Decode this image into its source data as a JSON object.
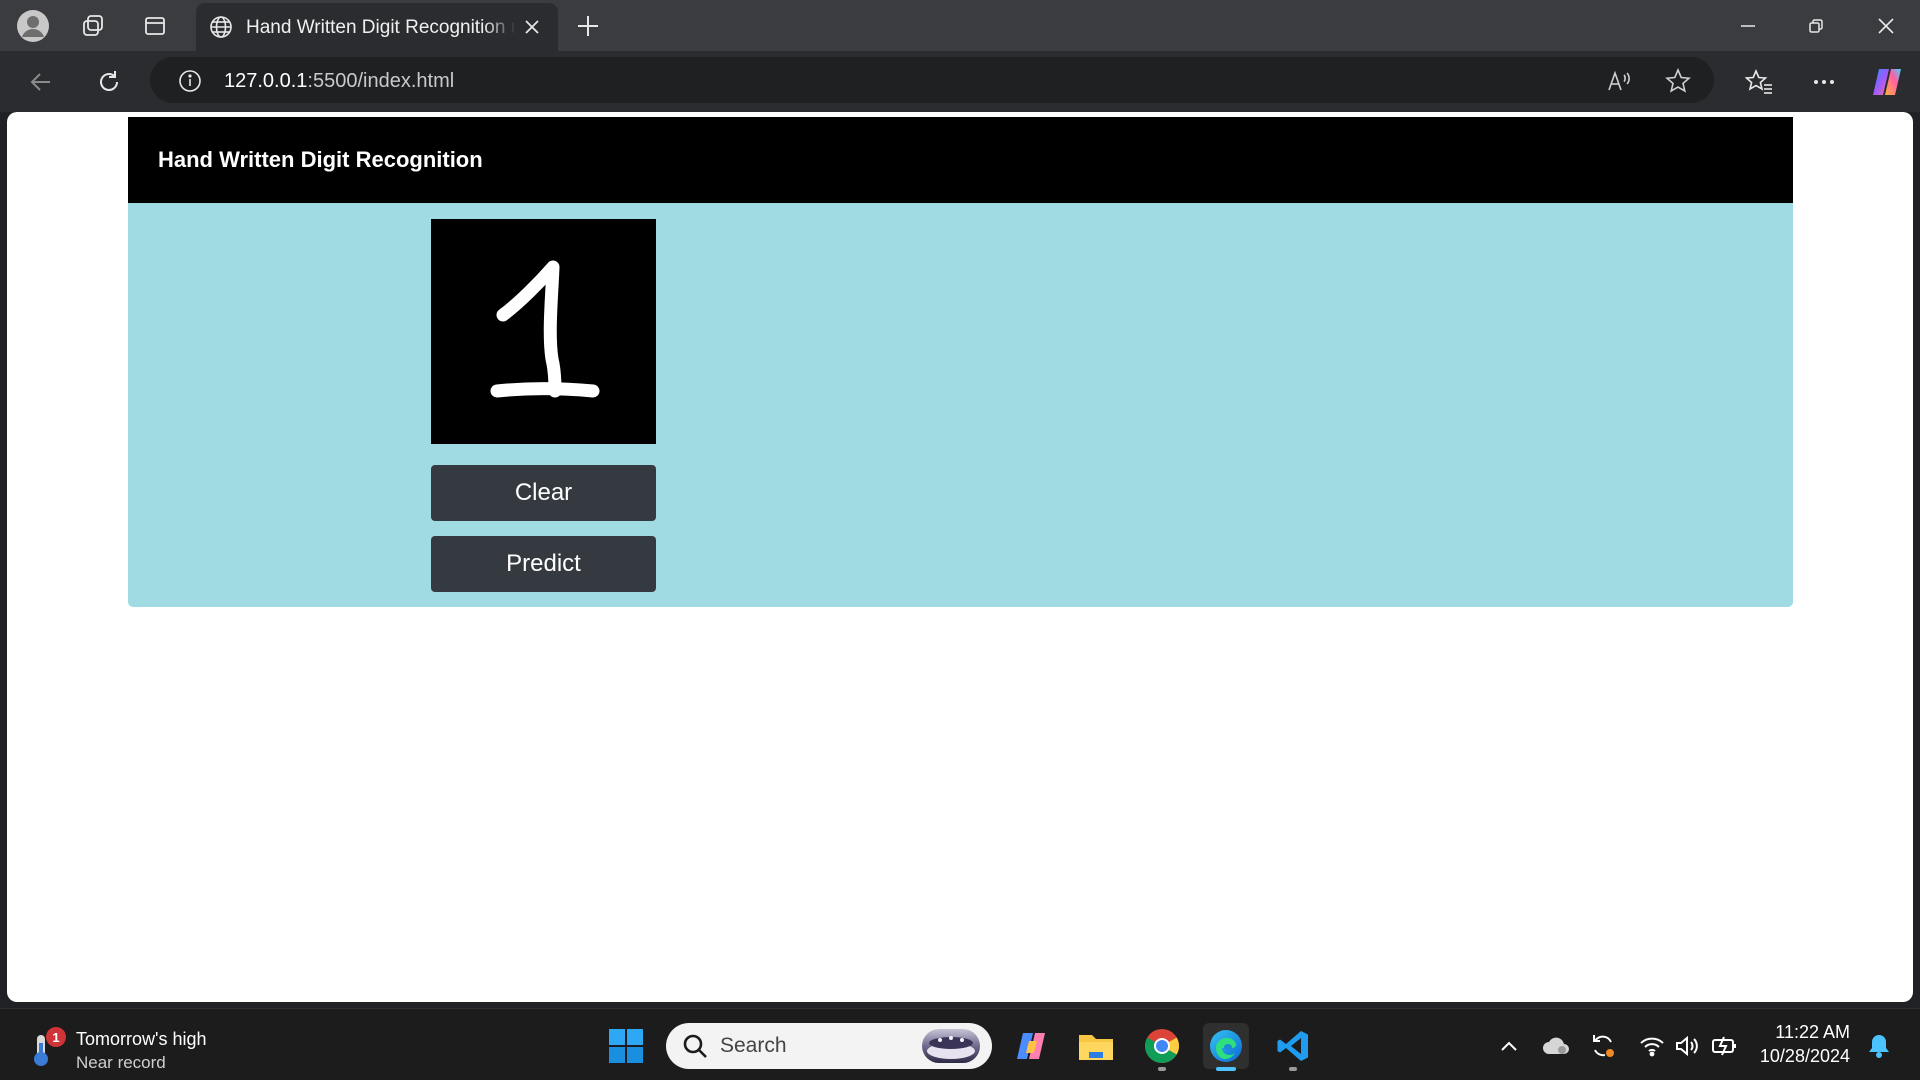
{
  "browser": {
    "tab_title": "Hand Written Digit Recognition using Machine Learning",
    "url_host": "127.0.0.1",
    "url_rest": ":5500/index.html"
  },
  "page": {
    "header_title": "Hand Written Digit Recognition",
    "canvas_digit": "1",
    "clear_label": "Clear",
    "predict_label": "Predict",
    "colors": {
      "header_bg": "#000000",
      "main_bg": "#a0dbe3",
      "button_bg": "#353a41",
      "canvas_bg": "#000000",
      "stroke": "#ffffff"
    }
  },
  "taskbar": {
    "weather_line1": "Tomorrow's high",
    "weather_line2": "Near record",
    "weather_badge": "1",
    "search_placeholder": "Search",
    "time": "11:22 AM",
    "date": "10/28/2024",
    "apps": [
      "start-icon",
      "copilot-icon",
      "file-explorer-icon",
      "chrome-icon",
      "edge-icon",
      "vscode-icon"
    ]
  }
}
